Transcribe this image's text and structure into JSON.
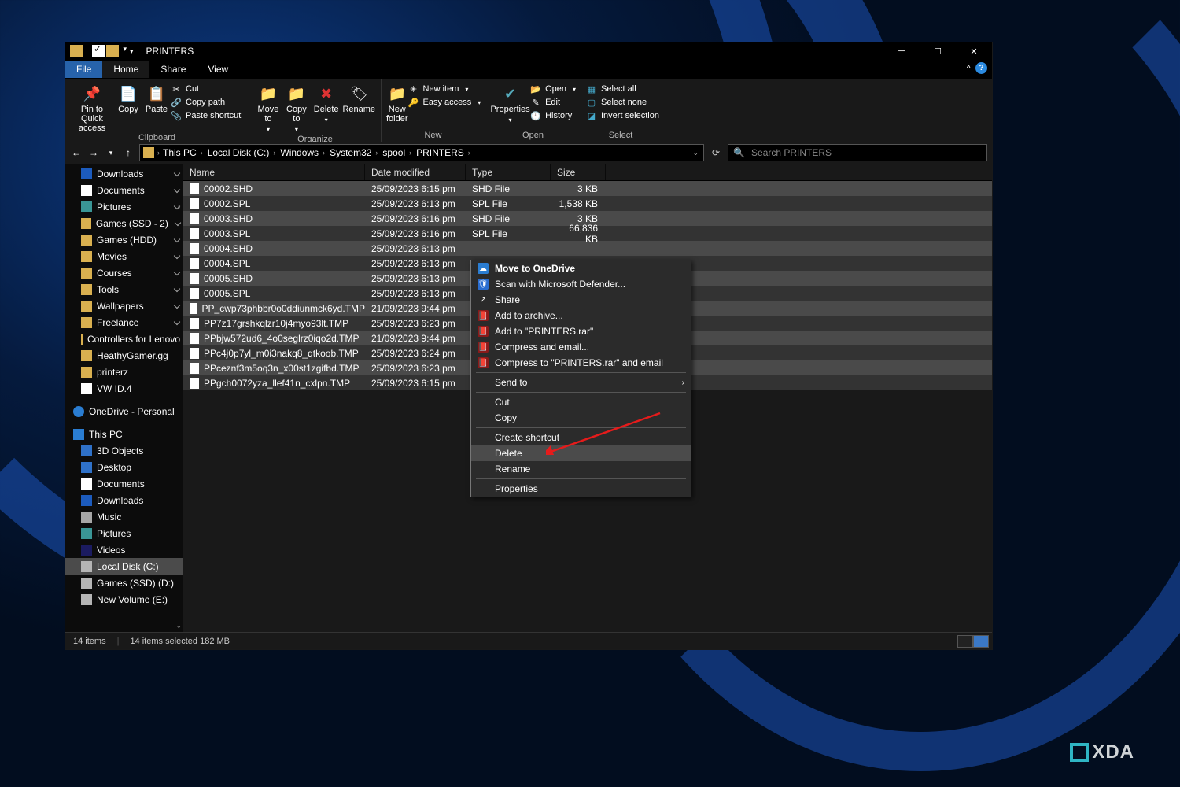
{
  "title": "PRINTERS",
  "menu": {
    "file": "File",
    "home": "Home",
    "share": "Share",
    "view": "View"
  },
  "ribbon": {
    "pin": "Pin to Quick access",
    "copy": "Copy",
    "paste": "Paste",
    "cut": "Cut",
    "copypath": "Copy path",
    "pasteshortcut": "Paste shortcut",
    "clipboard_label": "Clipboard",
    "moveto": "Move to",
    "copyto": "Copy to",
    "delete": "Delete",
    "rename": "Rename",
    "organize_label": "Organize",
    "newfolder": "New folder",
    "newitem": "New item",
    "easyaccess": "Easy access",
    "new_label": "New",
    "properties": "Properties",
    "open": "Open",
    "edit": "Edit",
    "history": "History",
    "open_label": "Open",
    "selectall": "Select all",
    "selectnone": "Select none",
    "invert": "Invert selection",
    "select_label": "Select"
  },
  "breadcrumb": [
    "This PC",
    "Local Disk (C:)",
    "Windows",
    "System32",
    "spool",
    "PRINTERS"
  ],
  "search_placeholder": "Search PRINTERS",
  "sidebar": [
    {
      "icon": "dl",
      "label": "Downloads",
      "pin": true
    },
    {
      "icon": "doc",
      "label": "Documents",
      "pin": true
    },
    {
      "icon": "pic",
      "label": "Pictures",
      "pin": true,
      "caret": "›"
    },
    {
      "icon": "fold",
      "label": "Games (SSD - 2)",
      "pin": true
    },
    {
      "icon": "fold",
      "label": "Games (HDD)",
      "pin": true
    },
    {
      "icon": "fold",
      "label": "Movies",
      "pin": true
    },
    {
      "icon": "fold",
      "label": "Courses",
      "pin": true
    },
    {
      "icon": "fold",
      "label": "Tools",
      "pin": true
    },
    {
      "icon": "fold",
      "label": "Wallpapers",
      "pin": true
    },
    {
      "icon": "fold",
      "label": "Freelance",
      "pin": true
    },
    {
      "icon": "fold",
      "label": "Controllers for Lenovo"
    },
    {
      "icon": "fold",
      "label": "HeathyGamer.gg"
    },
    {
      "icon": "fold",
      "label": "printerz"
    },
    {
      "icon": "doc",
      "label": "VW ID.4"
    },
    {
      "spacer": true
    },
    {
      "icon": "cloud",
      "label": "OneDrive - Personal",
      "top": true
    },
    {
      "spacer": true
    },
    {
      "icon": "pc",
      "label": "This PC",
      "top": true
    },
    {
      "icon": "desk",
      "label": "3D Objects"
    },
    {
      "icon": "desk",
      "label": "Desktop"
    },
    {
      "icon": "doc",
      "label": "Documents"
    },
    {
      "icon": "dl",
      "label": "Downloads"
    },
    {
      "icon": "note",
      "label": "Music"
    },
    {
      "icon": "pic",
      "label": "Pictures"
    },
    {
      "icon": "vid",
      "label": "Videos"
    },
    {
      "icon": "disk",
      "label": "Local Disk (C:)",
      "sel": true
    },
    {
      "icon": "disk",
      "label": "Games (SSD) (D:)"
    },
    {
      "icon": "disk",
      "label": "New Volume (E:)"
    }
  ],
  "columns": {
    "name": "Name",
    "date": "Date modified",
    "type": "Type",
    "size": "Size"
  },
  "files": [
    {
      "n": "00002.SHD",
      "d": "25/09/2023 6:15 pm",
      "t": "SHD File",
      "s": "3 KB"
    },
    {
      "n": "00002.SPL",
      "d": "25/09/2023 6:13 pm",
      "t": "SPL File",
      "s": "1,538 KB",
      "dark": true
    },
    {
      "n": "00003.SHD",
      "d": "25/09/2023 6:16 pm",
      "t": "SHD File",
      "s": "3 KB"
    },
    {
      "n": "00003.SPL",
      "d": "25/09/2023 6:16 pm",
      "t": "SPL File",
      "s": "66,836 KB",
      "dark": true
    },
    {
      "n": "00004.SHD",
      "d": "25/09/2023 6:13 pm",
      "t": "",
      "s": ""
    },
    {
      "n": "00004.SPL",
      "d": "25/09/2023 6:13 pm",
      "t": "",
      "s": "",
      "dark": true
    },
    {
      "n": "00005.SHD",
      "d": "25/09/2023 6:13 pm",
      "t": "",
      "s": ""
    },
    {
      "n": "00005.SPL",
      "d": "25/09/2023 6:13 pm",
      "t": "",
      "s": "",
      "dark": true
    },
    {
      "n": "PP_cwp73phbbr0o0ddiunmck6yd.TMP",
      "d": "21/09/2023 9:44 pm",
      "t": "",
      "s": ""
    },
    {
      "n": "PP7z17grshkqlzr10j4myo93lt.TMP",
      "d": "25/09/2023 6:23 pm",
      "t": "",
      "s": "",
      "dark": true
    },
    {
      "n": "PPbjw572ud6_4o0seglrz0iqo2d.TMP",
      "d": "21/09/2023 9:44 pm",
      "t": "",
      "s": ""
    },
    {
      "n": "PPc4j0p7yl_m0i3nakq8_qtkoob.TMP",
      "d": "25/09/2023 6:24 pm",
      "t": "",
      "s": "",
      "dark": true
    },
    {
      "n": "PPceznf3m5oq3n_x00st1zgifbd.TMP",
      "d": "25/09/2023 6:23 pm",
      "t": "",
      "s": ""
    },
    {
      "n": "PPgch0072yza_llef41n_cxlpn.TMP",
      "d": "25/09/2023 6:15 pm",
      "t": "",
      "s": "",
      "dark": true
    }
  ],
  "context": [
    {
      "icon": "☁",
      "label": "Move to OneDrive",
      "bold": true,
      "iconbg": "#2a7dd2"
    },
    {
      "icon": "🛡",
      "label": "Scan with Microsoft Defender...",
      "iconbg": "#2a6dd0"
    },
    {
      "icon": "↗",
      "label": "Share"
    },
    {
      "icon": "📕",
      "label": "Add to archive...",
      "iconbg": "#8a1a1a"
    },
    {
      "icon": "📕",
      "label": "Add to \"PRINTERS.rar\"",
      "iconbg": "#8a1a1a"
    },
    {
      "icon": "📕",
      "label": "Compress and email...",
      "iconbg": "#8a1a1a"
    },
    {
      "icon": "📕",
      "label": "Compress to \"PRINTERS.rar\" and email",
      "iconbg": "#8a1a1a"
    },
    {
      "sep": true
    },
    {
      "label": "Send to",
      "sub": true
    },
    {
      "sep": true
    },
    {
      "label": "Cut"
    },
    {
      "label": "Copy"
    },
    {
      "sep": true
    },
    {
      "label": "Create shortcut"
    },
    {
      "label": "Delete",
      "hover": true
    },
    {
      "label": "Rename"
    },
    {
      "sep": true
    },
    {
      "label": "Properties"
    }
  ],
  "status": {
    "items": "14 items",
    "selected": "14 items selected  182 MB"
  },
  "xda": "XDA"
}
